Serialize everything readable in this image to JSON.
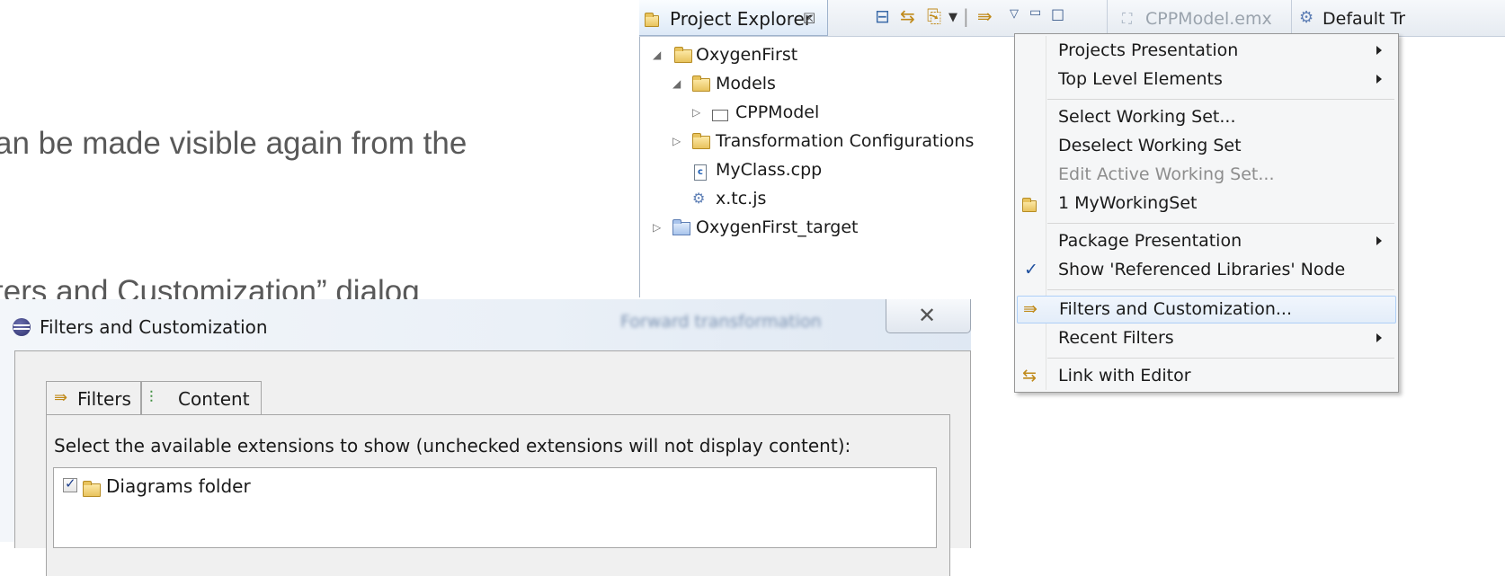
{
  "slide": {
    "line_partial_top": "",
    "line1": "an be made visible again from the",
    "line2": "ters and Customization” dialog"
  },
  "project_explorer": {
    "tab_label": "Project Explorer",
    "tab_close": "☒",
    "other_tabs": [
      "CPPModel.emx",
      "Default Tr"
    ],
    "tree": [
      {
        "label": "OxygenFirst",
        "icon": "project-folder-icon",
        "expanded": true
      },
      {
        "label": "Models",
        "icon": "models-folder-icon",
        "expanded": true
      },
      {
        "label": "CPPModel",
        "icon": "folder-icon",
        "expanded": false
      },
      {
        "label": "Transformation Configurations",
        "icon": "transformation-folder-icon",
        "expanded": false
      },
      {
        "label": "MyClass.cpp",
        "icon": "cpp-file-icon"
      },
      {
        "label": "x.tc.js",
        "icon": "tc-file-icon"
      },
      {
        "label": "OxygenFirst_target",
        "icon": "project-folder-icon",
        "expanded": false
      }
    ]
  },
  "menu": {
    "items": [
      {
        "label": "Projects Presentation",
        "submenu": true
      },
      {
        "label": "Top Level Elements",
        "submenu": true
      },
      {
        "label": "Select Working Set..."
      },
      {
        "label": "Deselect Working Set"
      },
      {
        "label": "Edit Active Working Set...",
        "disabled": true
      },
      {
        "label": "1 MyWorkingSet",
        "icon": "working-set-icon"
      },
      {
        "label": "Package Presentation",
        "submenu": true
      },
      {
        "label": "Show 'Referenced Libraries' Node",
        "checked": true
      },
      {
        "label": "Filters and Customization...",
        "icon": "filter-icon",
        "highlighted": true
      },
      {
        "label": "Recent Filters",
        "submenu": true
      },
      {
        "label": "Link with Editor",
        "icon": "link-icon"
      }
    ]
  },
  "dialog": {
    "title": "Filters and Customization",
    "background_text": "Forward transformation",
    "close": "✕",
    "tabs": [
      {
        "label": "Filters",
        "icon": "filter-icon"
      },
      {
        "label": "Content",
        "icon": "content-icon",
        "selected": true
      }
    ],
    "description": "Select the available extensions to show (unchecked extensions will not display content):",
    "extensions": [
      {
        "label": "Diagrams folder",
        "checked": true
      }
    ]
  }
}
